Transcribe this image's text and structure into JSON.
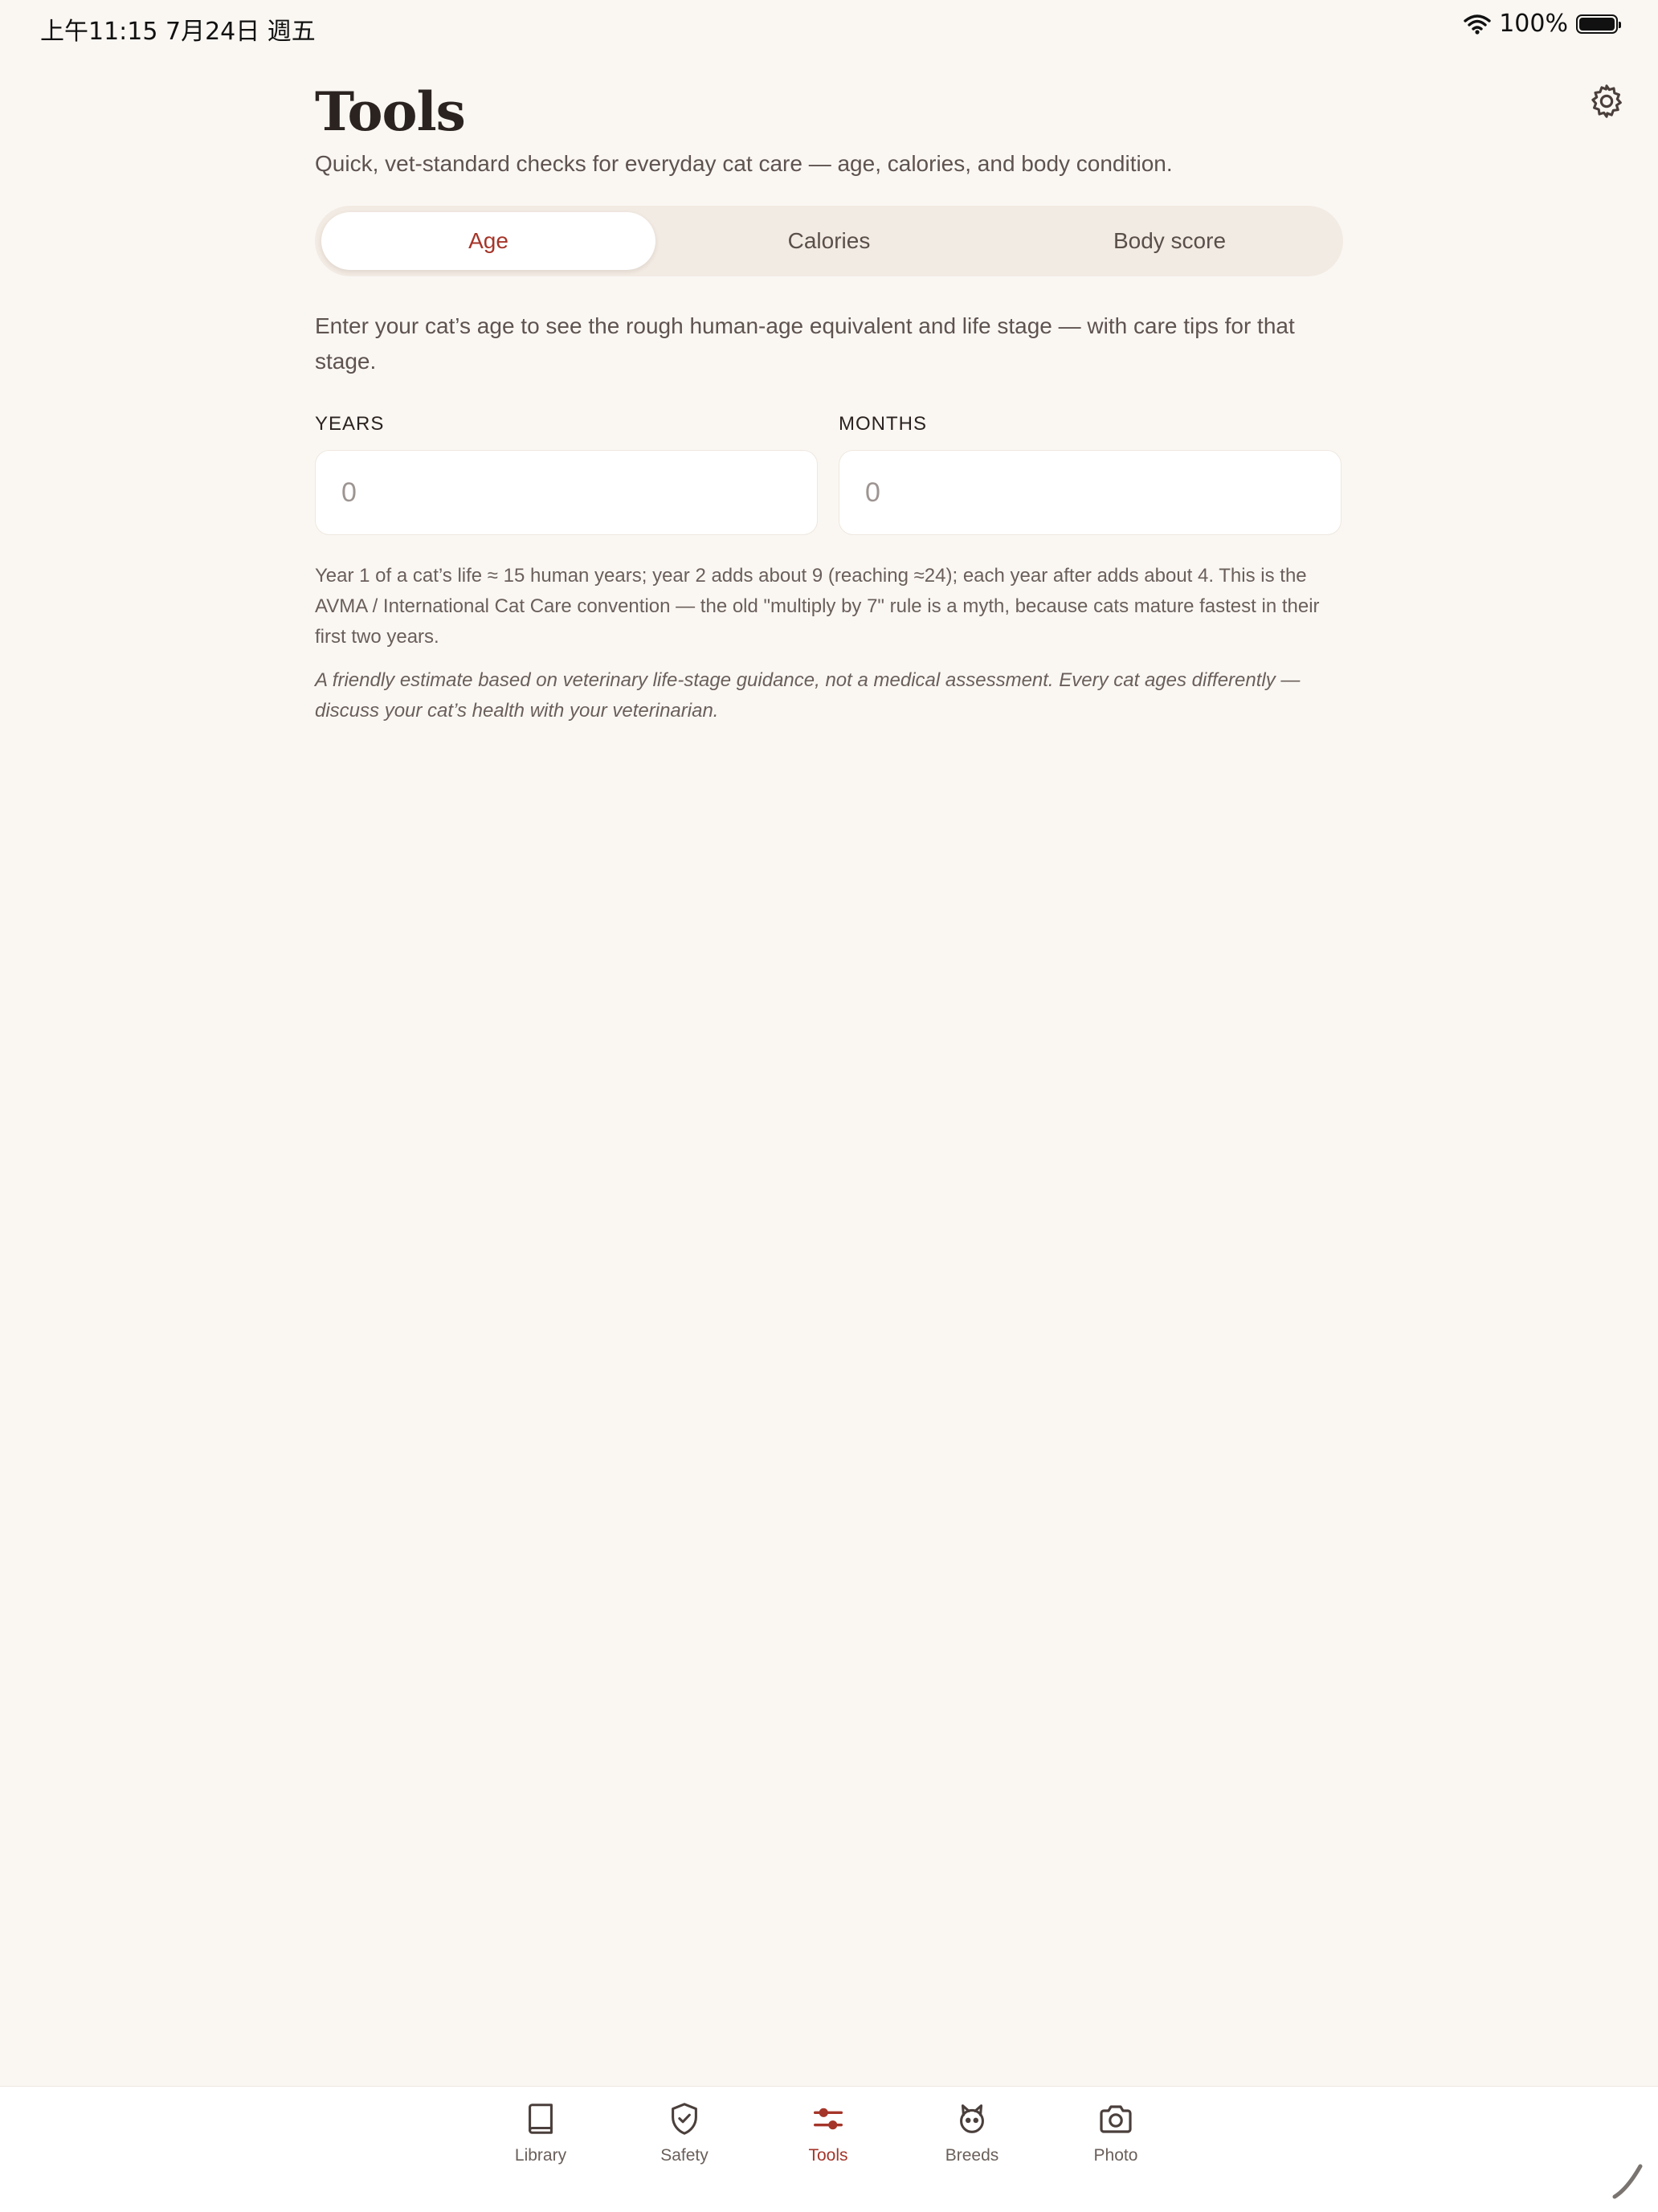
{
  "status_bar": {
    "time": "上午11:15   7月24日 週五",
    "battery_percent": "100%",
    "battery_level": 1.0
  },
  "header": {
    "title": "Tools",
    "subtitle": "Quick, vet-standard checks for everyday cat care — age, calories, and body condition.",
    "settings_icon": "gear-icon"
  },
  "tabs": [
    {
      "label": "Age",
      "selected": true
    },
    {
      "label": "Calories",
      "selected": false
    },
    {
      "label": "Body score",
      "selected": false
    }
  ],
  "age_tool": {
    "intro": "Enter your cat’s age to see the rough human-age equivalent and life stage — with care tips for that stage.",
    "years": {
      "label": "YEARS",
      "placeholder": "0",
      "value": ""
    },
    "months": {
      "label": "MONTHS",
      "placeholder": "0",
      "value": ""
    },
    "explanation": "Year 1 of a cat’s life ≈ 15 human years; year 2 adds about 9 (reaching ≈24); each year after adds about 4. This is the AVMA / International Cat Care convention — the old \"multiply by 7\" rule is a myth, because cats mature fastest in their first two years.",
    "disclaimer": "A friendly estimate based on veterinary life-stage guidance, not a medical assessment. Every cat ages differently — discuss your cat’s health with your veterinarian."
  },
  "bottom_nav": [
    {
      "label": "Library",
      "icon": "book-icon",
      "active": false
    },
    {
      "label": "Safety",
      "icon": "shield-check-icon",
      "active": false
    },
    {
      "label": "Tools",
      "icon": "sliders-icon",
      "active": true
    },
    {
      "label": "Breeds",
      "icon": "cat-face-icon",
      "active": false
    },
    {
      "label": "Photo",
      "icon": "camera-icon",
      "active": false
    }
  ],
  "colors": {
    "accent": "#a5352a",
    "background": "#faf7f3",
    "segment_background": "#f2ebe3",
    "text_primary": "#2b2320",
    "text_secondary": "#5e534f"
  }
}
